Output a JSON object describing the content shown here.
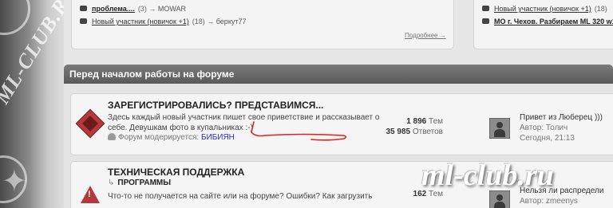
{
  "top_left": {
    "row1": {
      "title": "проблема....",
      "count": "(3)",
      "author": "→ MOWAR"
    },
    "row2": {
      "title": "Новый участник (новичок +1)",
      "count": "(18)",
      "author": "→ беркут77"
    },
    "more": "Подробнее →"
  },
  "top_right": {
    "row1": {
      "title": "Новый участник (новичок +1)",
      "count": "(18)"
    },
    "row2": {
      "title": "МО г. Чехов. Разбираем ML 320 w1"
    }
  },
  "section": {
    "title": "Перед началом работы на форуме"
  },
  "forums": [
    {
      "title": "ЗАРЕГИСТРИРОВАЛИСЬ? ПРЕДСТАВИМСЯ...",
      "desc_line1": "Здесь каждый новый участник пишет свое приветствие и рассказывает о",
      "desc_line2": "себе. Девушкам фото в купальниках :-)",
      "mod_label": "Форум модерируется:",
      "mod_name": "БИБИЯН",
      "topics": "1 896",
      "topics_label": "Тем",
      "posts": "35 985",
      "posts_label": "Ответов",
      "last_title": "Привет из Люберец )))",
      "last_author": "Автор: Толич",
      "last_time": "Сегодня, 21:13"
    },
    {
      "title": "ТЕХНИЧЕСКАЯ ПОДДЕРЖКА",
      "subforum": "ПРОГРАММЫ",
      "desc_line1": "Что-то не получается на сайте или на форуме? Ошибки? Как загрузить",
      "desc_line2": "",
      "topics": "162",
      "topics_label": "Тем",
      "last_title": "Нельзя ли распредели",
      "last_author": "Автор: zmeenys"
    }
  ],
  "watermarks": {
    "left": "ML-CLUB.RU",
    "right": "ml-club.ru"
  },
  "colors": {
    "header_bg": "#666666",
    "moderator_link": "#2b2be0",
    "annotation_red": "#e0231f",
    "forum_icon": "#b23a3a"
  }
}
